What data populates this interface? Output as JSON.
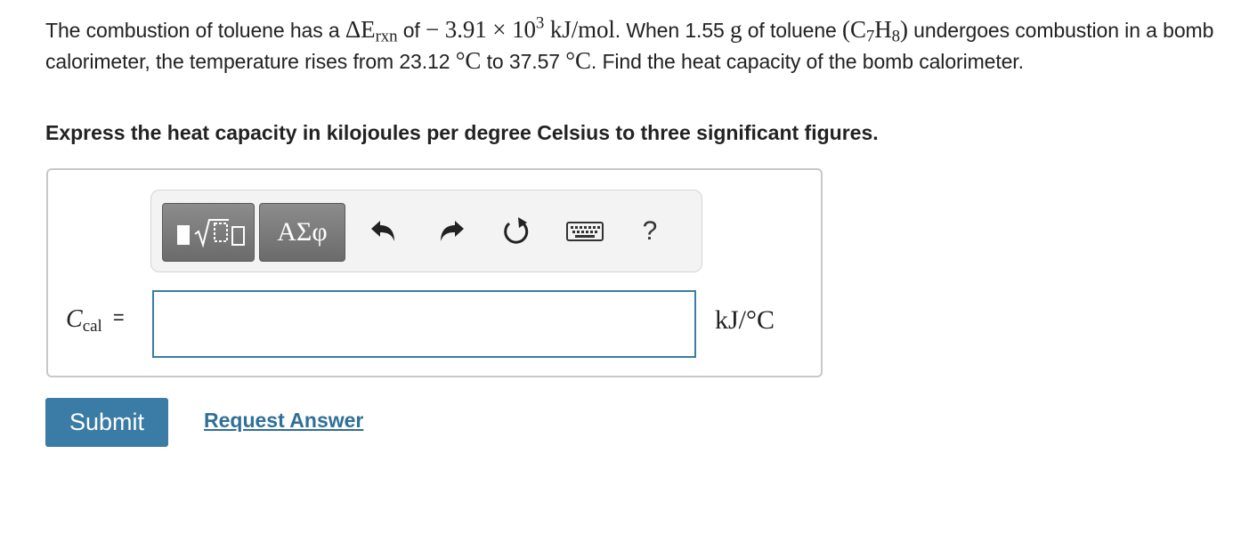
{
  "problem": {
    "p1": "The combustion of toluene has a ",
    "delta_e": "ΔE",
    "delta_e_sub": "rxn",
    "p2": " of ",
    "value": "− 3.91 × 10",
    "value_exp": "3",
    "value_unit": " kJ/mol",
    "p3": ". When 1.55 ",
    "mass_unit": "g",
    "p4": " of toluene ",
    "formula_open": "(C",
    "formula_c_sub": "7",
    "formula_h": "H",
    "formula_h_sub": "8",
    "formula_close": ")",
    "p5": " undergoes combustion in a bomb calorimeter, the temperature rises from 23.12 ",
    "deg_c1": "°C",
    "p6": " to 37.57 ",
    "deg_c2": "°C",
    "p7": ". Find the heat capacity of the bomb calorimeter."
  },
  "instruction": "Express the heat capacity in kilojoules per degree Celsius to three significant figures.",
  "toolbar": {
    "symbols_label": "ΑΣφ",
    "help_label": "?"
  },
  "answer": {
    "label_var": "C",
    "label_sub": "cal",
    "label_eq": "=",
    "value": "",
    "units": "kJ/°C"
  },
  "actions": {
    "submit_label": "Submit",
    "request_label": "Request Answer"
  },
  "colors": {
    "accent": "#3a7ca5",
    "link": "#2f6f99",
    "toolbar_bg": "#f3f3f3"
  }
}
